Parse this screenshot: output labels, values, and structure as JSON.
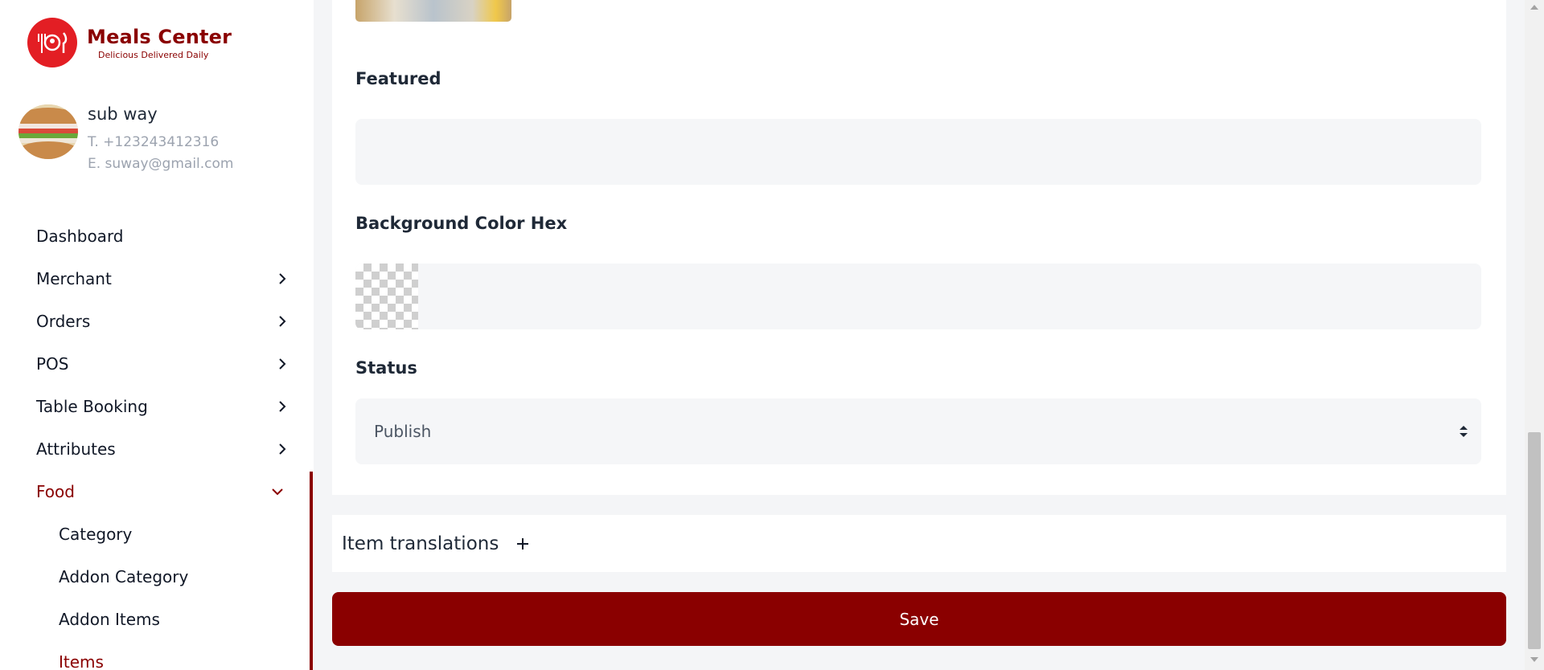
{
  "brand": {
    "name": "Meals Center",
    "tagline": "Delicious Delivered Daily",
    "color": "#8a0000",
    "logo_color": "#e31e24"
  },
  "merchant": {
    "name": "sub way",
    "phone": "T. +123243412316",
    "email": "E. suway@gmail.com"
  },
  "sidebar": {
    "items": [
      {
        "label": "Dashboard",
        "has_arrow": false
      },
      {
        "label": "Merchant",
        "has_arrow": true
      },
      {
        "label": "Orders",
        "has_arrow": true
      },
      {
        "label": "POS",
        "has_arrow": true
      },
      {
        "label": "Table Booking",
        "has_arrow": true
      },
      {
        "label": "Attributes",
        "has_arrow": true
      },
      {
        "label": "Food",
        "has_arrow": true,
        "expanded": true
      }
    ],
    "food_sub": [
      {
        "label": "Category"
      },
      {
        "label": "Addon Category"
      },
      {
        "label": "Addon Items"
      },
      {
        "label": "Items",
        "active": true
      }
    ]
  },
  "form": {
    "featured_label": "Featured",
    "bg_color_label": "Background Color Hex",
    "status_label": "Status",
    "status_value": "Publish"
  },
  "translations": {
    "label": "Item translations",
    "icon": "plus-icon"
  },
  "actions": {
    "save_label": "Save"
  }
}
